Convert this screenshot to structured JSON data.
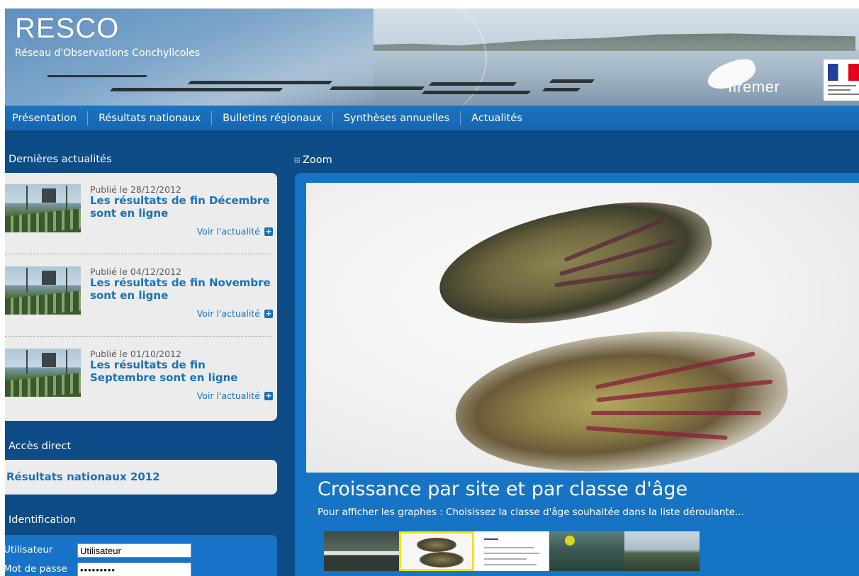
{
  "header": {
    "site_name": "RESCO",
    "site_subtitle": "Réseau d'Observations Conchylicoles",
    "partner_logo": "Ifremer"
  },
  "nav": {
    "items": [
      {
        "label": "Présentation"
      },
      {
        "label": "Résultats nationaux"
      },
      {
        "label": "Bulletins régionaux"
      },
      {
        "label": "Synthèses annuelles"
      },
      {
        "label": "Actualités"
      }
    ]
  },
  "news": {
    "section_title": "Dernières actualités",
    "items": [
      {
        "date": "Publié le 28/12/2012",
        "title": "Les résultats de fin Décembre sont en ligne",
        "more": "Voir l'actualité"
      },
      {
        "date": "Publié le 04/12/2012",
        "title": "Les résultats de fin Novembre sont en ligne",
        "more": "Voir l'actualité"
      },
      {
        "date": "Publié le 01/10/2012",
        "title": "Les résultats de fin Septembre sont en ligne",
        "more": "Voir l'actualité"
      }
    ]
  },
  "direct_access": {
    "section_title": "Accès direct",
    "link": "Résultats nationaux 2012"
  },
  "identification": {
    "section_title": "Identification",
    "user_label": "Utilisateur",
    "user_value": "Utilisateur",
    "password_label": "Mot de passe",
    "password_value": "•••••••••"
  },
  "zoom": {
    "section_title": "Zoom",
    "caption_title": "Croissance par site et par classe d'âge",
    "caption_subtitle": "Pour afficher les graphes : Choisissez la classe d'âge souhaitée dans la liste déroulante..."
  },
  "icons": {
    "news_more": "plus-square-icon",
    "zoom_title": "grip-icon"
  },
  "colors": {
    "nav": "#1d74c0",
    "link": "#1872b9",
    "background": "#0d4c86",
    "active_thumb_border": "#f2e600"
  }
}
